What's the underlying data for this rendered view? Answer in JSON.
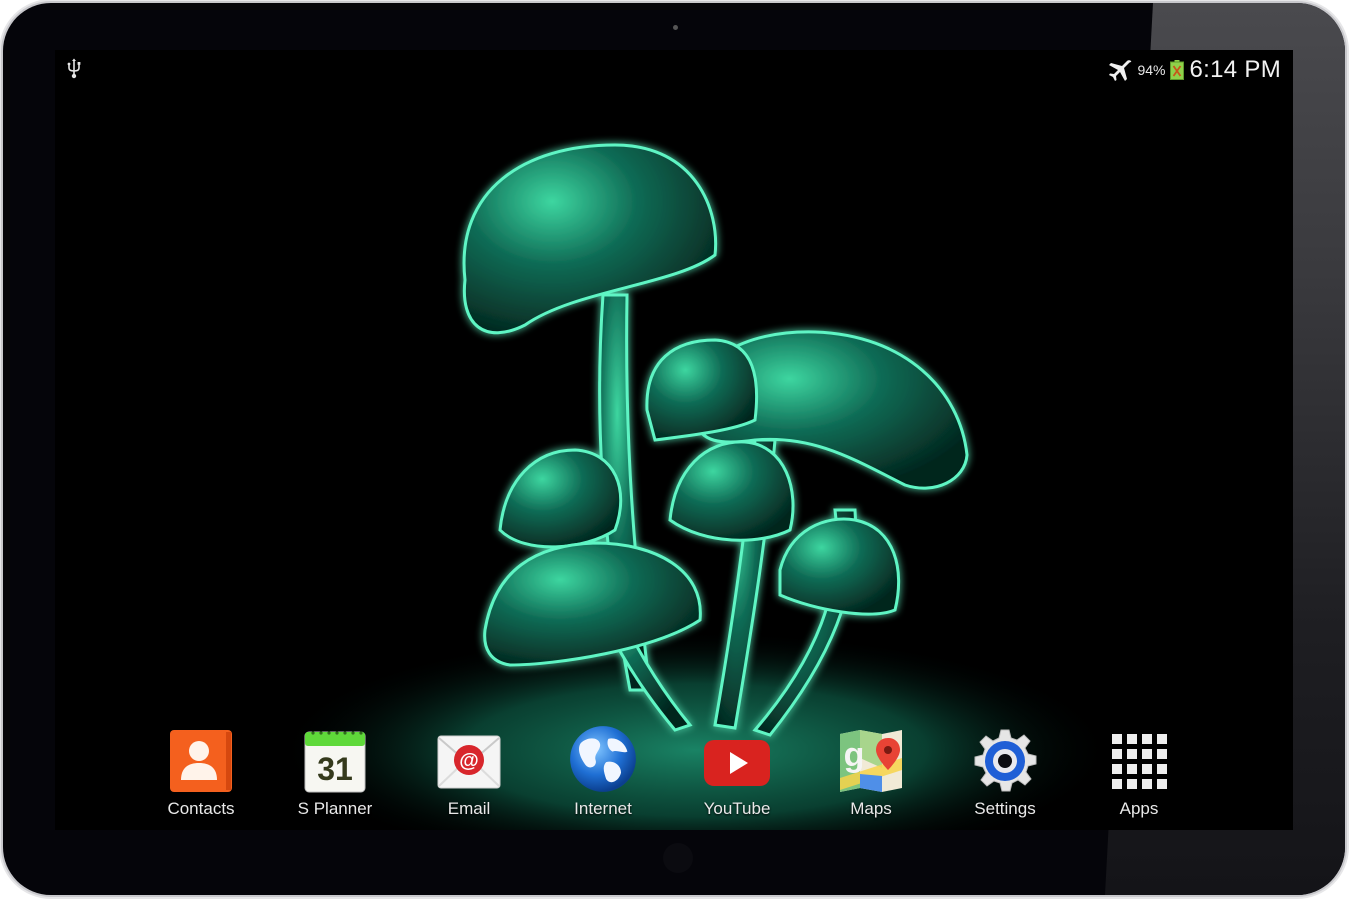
{
  "device": "tablet",
  "status_bar": {
    "left_icons": [
      "usb-icon"
    ],
    "right_icons": [
      "airplane-mode-icon",
      "battery-icon"
    ],
    "battery_percent": "94%",
    "time": "6:14 PM"
  },
  "wallpaper": {
    "description": "glowing neon green mushrooms on black",
    "accent_color": "#3fe6b0"
  },
  "dock": {
    "apps": [
      {
        "label": "Contacts",
        "icon": "contacts-icon",
        "color": "#f4601e"
      },
      {
        "label": "S Planner",
        "icon": "calendar-icon",
        "date": "31",
        "color": "#5fd93a"
      },
      {
        "label": "Email",
        "icon": "email-icon",
        "color": "#d8262c"
      },
      {
        "label": "Internet",
        "icon": "globe-icon",
        "color": "#2a7fe0"
      },
      {
        "label": "YouTube",
        "icon": "youtube-icon",
        "color": "#d9231f"
      },
      {
        "label": "Maps",
        "icon": "maps-icon",
        "color": "#e84335"
      },
      {
        "label": "Settings",
        "icon": "settings-gear-icon",
        "color": "#1f5fd6"
      },
      {
        "label": "Apps",
        "icon": "app-grid-icon",
        "color": "#eeeeee"
      }
    ]
  }
}
